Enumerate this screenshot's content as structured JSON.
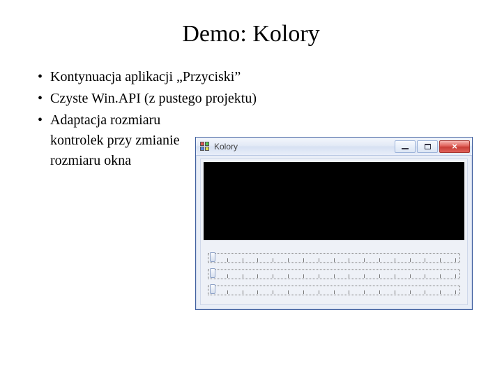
{
  "slide": {
    "title": "Demo: Kolory",
    "bullets": [
      "Kontynuacja aplikacji „Przyciski”",
      "Czyste Win.API (z pustego projektu)",
      "Adaptacja rozmiaru kontrolek przy zmianie rozmiaru okna"
    ]
  },
  "window": {
    "title": "Kolory",
    "panel_color": "#000000",
    "sliders": {
      "r": 0,
      "g": 0,
      "b": 0
    }
  }
}
